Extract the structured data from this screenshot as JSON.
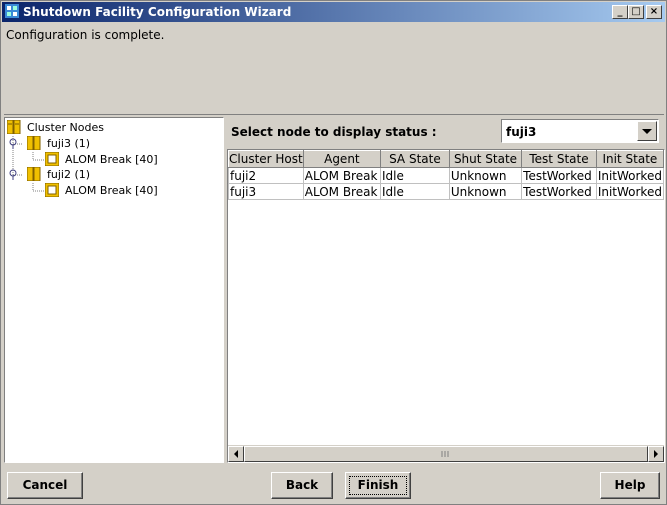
{
  "window": {
    "title": "Shutdown Facility Configuration Wizard",
    "minimize_label": "_",
    "maximize_label": "□",
    "close_label": "×"
  },
  "message": "Configuration is complete.",
  "tree": {
    "root": "Cluster Nodes",
    "nodes": [
      {
        "label": "fuji3 (1)",
        "child": "ALOM Break [40]"
      },
      {
        "label": "fuji2 (1)",
        "child": "ALOM Break [40]"
      }
    ]
  },
  "status": {
    "select_label": "Select node to display status :",
    "selected_node": "fuji3"
  },
  "table": {
    "columns": [
      "Cluster Host",
      "Agent",
      "SA State",
      "Shut State",
      "Test State",
      "Init State"
    ],
    "rows": [
      [
        "fuji2",
        "ALOM Break",
        "Idle",
        "Unknown",
        "TestWorked",
        "InitWorked"
      ],
      [
        "fuji3",
        "ALOM Break",
        "Idle",
        "Unknown",
        "TestWorked",
        "InitWorked"
      ]
    ]
  },
  "buttons": {
    "cancel": "Cancel",
    "back": "Back",
    "finish": "Finish",
    "help": "Help"
  },
  "colors": {
    "titlebar_start": "#0a246a",
    "titlebar_end": "#a6caf0",
    "panel": "#d4d0c8",
    "node_icon": "#f0c000"
  }
}
